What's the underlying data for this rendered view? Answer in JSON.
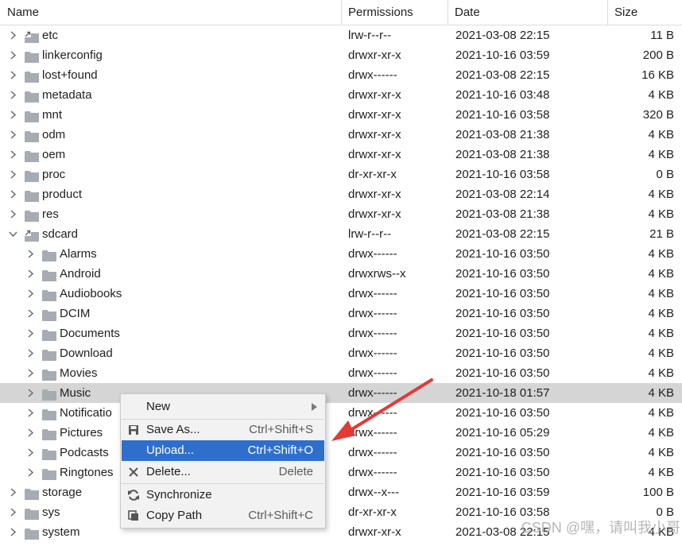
{
  "columns": {
    "name": "Name",
    "permissions": "Permissions",
    "date": "Date",
    "size": "Size"
  },
  "rows": [
    {
      "name": "etc",
      "perm": "lrw-r--r--",
      "date": "2021-03-08 22:15",
      "size": "11 B",
      "level": 0,
      "expanded": false,
      "link": true
    },
    {
      "name": "linkerconfig",
      "perm": "drwxr-xr-x",
      "date": "2021-10-16 03:59",
      "size": "200 B",
      "level": 0,
      "expanded": false,
      "link": false
    },
    {
      "name": "lost+found",
      "perm": "drwx------",
      "date": "2021-03-08 22:15",
      "size": "16 KB",
      "level": 0,
      "expanded": false,
      "link": false
    },
    {
      "name": "metadata",
      "perm": "drwxr-xr-x",
      "date": "2021-10-16 03:48",
      "size": "4 KB",
      "level": 0,
      "expanded": false,
      "link": false
    },
    {
      "name": "mnt",
      "perm": "drwxr-xr-x",
      "date": "2021-10-16 03:58",
      "size": "320 B",
      "level": 0,
      "expanded": false,
      "link": false
    },
    {
      "name": "odm",
      "perm": "drwxr-xr-x",
      "date": "2021-03-08 21:38",
      "size": "4 KB",
      "level": 0,
      "expanded": false,
      "link": false
    },
    {
      "name": "oem",
      "perm": "drwxr-xr-x",
      "date": "2021-03-08 21:38",
      "size": "4 KB",
      "level": 0,
      "expanded": false,
      "link": false
    },
    {
      "name": "proc",
      "perm": "dr-xr-xr-x",
      "date": "2021-10-16 03:58",
      "size": "0 B",
      "level": 0,
      "expanded": false,
      "link": false
    },
    {
      "name": "product",
      "perm": "drwxr-xr-x",
      "date": "2021-03-08 22:14",
      "size": "4 KB",
      "level": 0,
      "expanded": false,
      "link": false
    },
    {
      "name": "res",
      "perm": "drwxr-xr-x",
      "date": "2021-03-08 21:38",
      "size": "4 KB",
      "level": 0,
      "expanded": false,
      "link": false
    },
    {
      "name": "sdcard",
      "perm": "lrw-r--r--",
      "date": "2021-03-08 22:15",
      "size": "21 B",
      "level": 0,
      "expanded": true,
      "link": true
    },
    {
      "name": "Alarms",
      "perm": "drwx------",
      "date": "2021-10-16 03:50",
      "size": "4 KB",
      "level": 1,
      "expanded": false,
      "link": false
    },
    {
      "name": "Android",
      "perm": "drwxrws--x",
      "date": "2021-10-16 03:50",
      "size": "4 KB",
      "level": 1,
      "expanded": false,
      "link": false
    },
    {
      "name": "Audiobooks",
      "perm": "drwx------",
      "date": "2021-10-16 03:50",
      "size": "4 KB",
      "level": 1,
      "expanded": false,
      "link": false
    },
    {
      "name": "DCIM",
      "perm": "drwx------",
      "date": "2021-10-16 03:50",
      "size": "4 KB",
      "level": 1,
      "expanded": false,
      "link": false
    },
    {
      "name": "Documents",
      "perm": "drwx------",
      "date": "2021-10-16 03:50",
      "size": "4 KB",
      "level": 1,
      "expanded": false,
      "link": false
    },
    {
      "name": "Download",
      "perm": "drwx------",
      "date": "2021-10-16 03:50",
      "size": "4 KB",
      "level": 1,
      "expanded": false,
      "link": false
    },
    {
      "name": "Movies",
      "perm": "drwx------",
      "date": "2021-10-16 03:50",
      "size": "4 KB",
      "level": 1,
      "expanded": false,
      "link": false
    },
    {
      "name": "Music",
      "perm": "drwx------",
      "date": "2021-10-18 01:57",
      "size": "4 KB",
      "level": 1,
      "expanded": false,
      "link": false,
      "selected": true
    },
    {
      "name": "Notificatio",
      "perm": "drwx------",
      "date": "2021-10-16 03:50",
      "size": "4 KB",
      "level": 1,
      "expanded": false,
      "link": false
    },
    {
      "name": "Pictures",
      "perm": "drwx------",
      "date": "2021-10-16 05:29",
      "size": "4 KB",
      "level": 1,
      "expanded": false,
      "link": false
    },
    {
      "name": "Podcasts",
      "perm": "drwx------",
      "date": "2021-10-16 03:50",
      "size": "4 KB",
      "level": 1,
      "expanded": false,
      "link": false
    },
    {
      "name": "Ringtones",
      "perm": "drwx------",
      "date": "2021-10-16 03:50",
      "size": "4 KB",
      "level": 1,
      "expanded": false,
      "link": false
    },
    {
      "name": "storage",
      "perm": "drwx--x---",
      "date": "2021-10-16 03:59",
      "size": "100 B",
      "level": 0,
      "expanded": false,
      "link": false
    },
    {
      "name": "sys",
      "perm": "dr-xr-xr-x",
      "date": "2021-10-16 03:58",
      "size": "0 B",
      "level": 0,
      "expanded": false,
      "link": false
    },
    {
      "name": "system",
      "perm": "drwxr-xr-x",
      "date": "2021-03-08 22:15",
      "size": "4 KB",
      "level": 0,
      "expanded": false,
      "link": false
    }
  ],
  "context_menu": {
    "new_label": "New",
    "save_as_label": "Save As...",
    "save_as_shortcut": "Ctrl+Shift+S",
    "upload_label": "Upload...",
    "upload_shortcut": "Ctrl+Shift+O",
    "delete_label": "Delete...",
    "delete_shortcut": "Delete",
    "synchronize_label": "Synchronize",
    "copy_path_label": "Copy Path",
    "copy_path_shortcut": "Ctrl+Shift+C"
  },
  "watermark": "CSDN @嘿，请叫我小哥",
  "colors": {
    "selection_row": "#d5d5d5",
    "menu_active": "#2f6fcc",
    "folder": "#a7abb2",
    "annotation_arrow": "#e53935"
  },
  "icons": {
    "folder": "folder-icon",
    "symlink_folder": "folder-link-icon",
    "collapsed": "chevron-right-icon",
    "expanded": "chevron-down-icon",
    "save": "save-icon",
    "delete": "close-icon",
    "sync": "sync-icon",
    "copy": "copy-icon",
    "submenu": "triangle-right-icon"
  }
}
